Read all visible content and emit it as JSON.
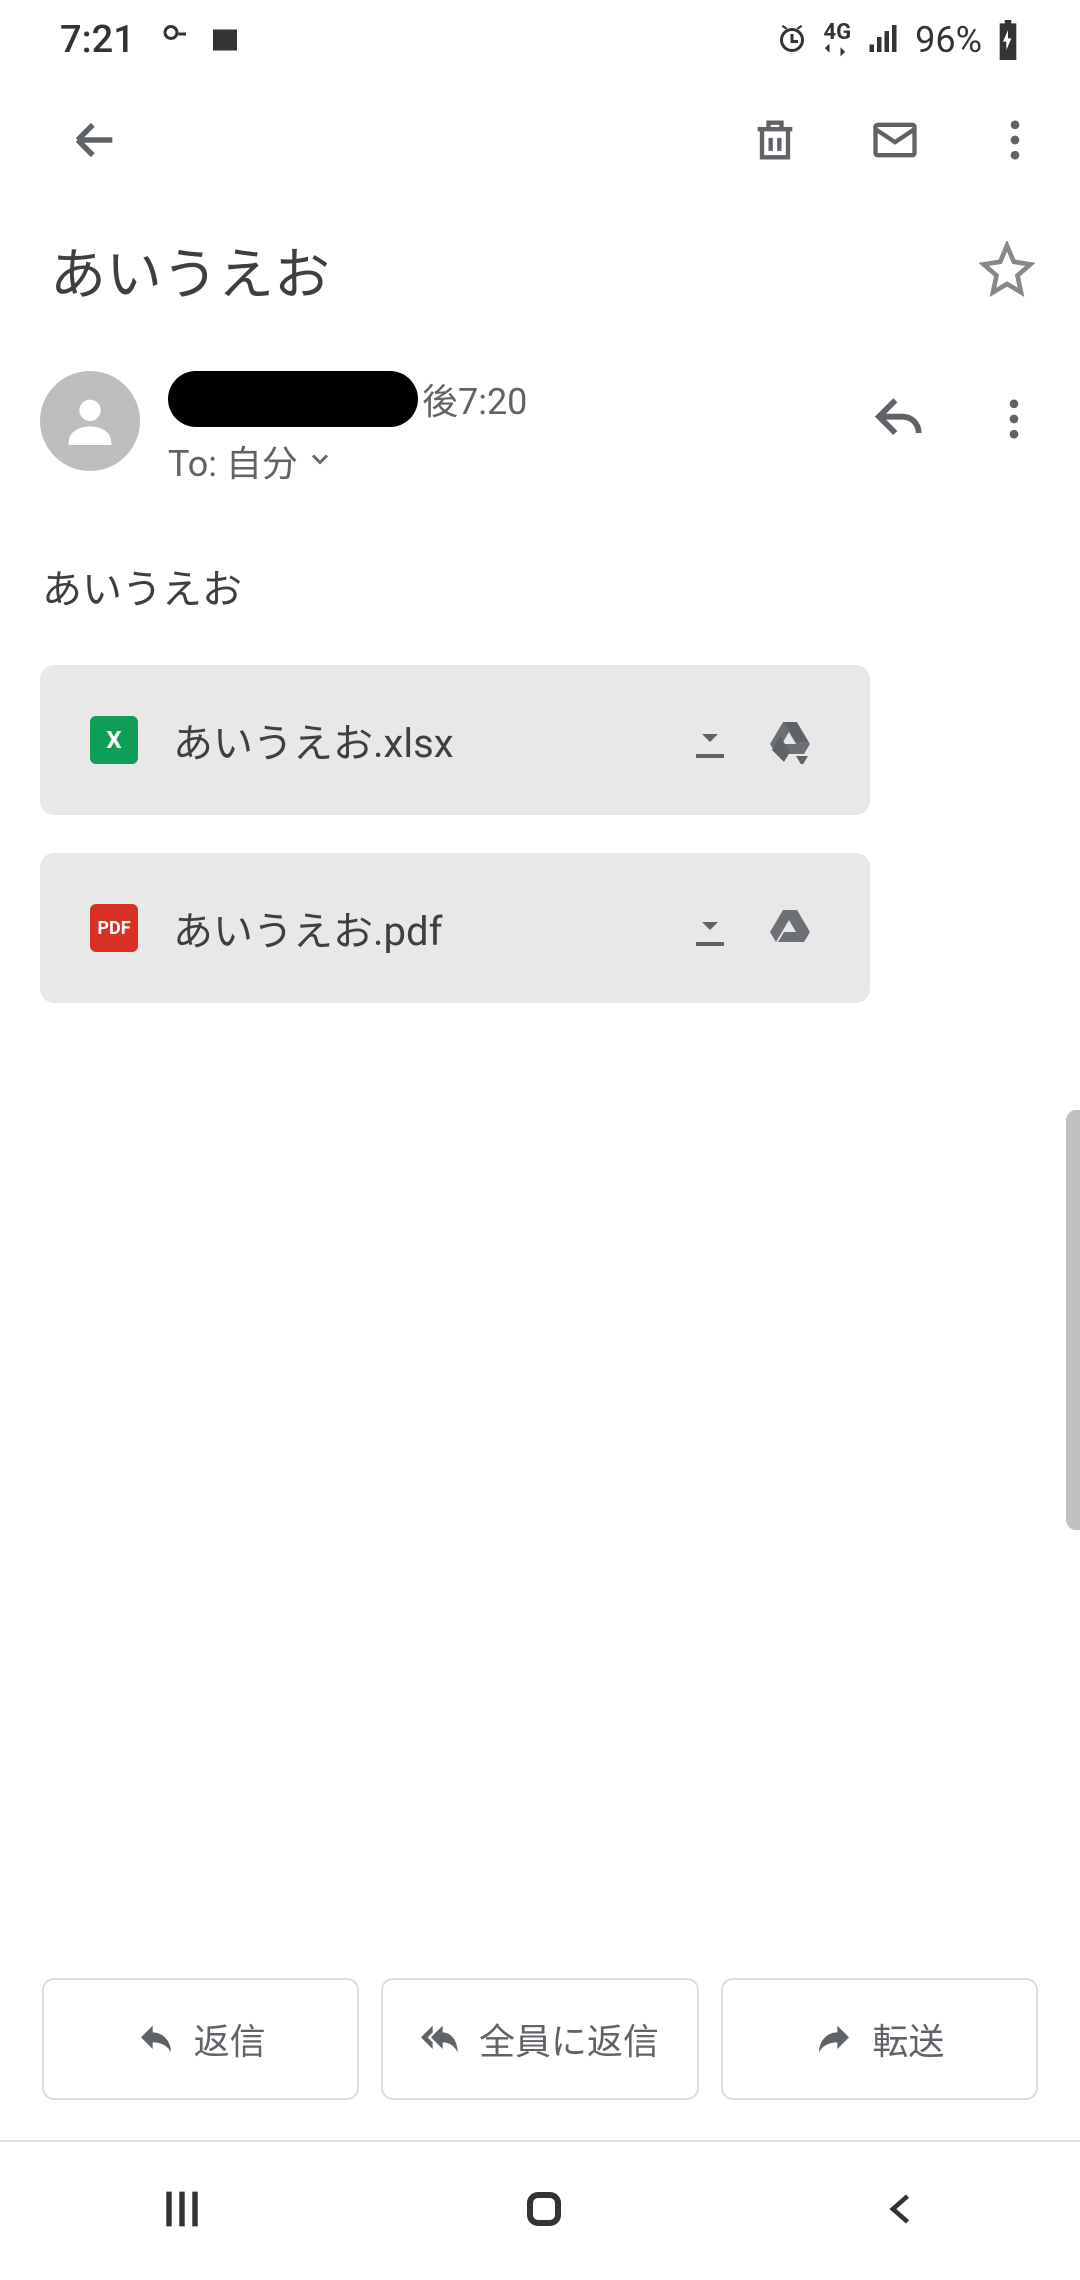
{
  "status": {
    "time": "7:21",
    "network_label": "4G",
    "battery": "96%"
  },
  "subject": "あいうえお",
  "message": {
    "time": "後7:20",
    "to_label": "To: 自分"
  },
  "body": "あいうえお",
  "attachments": [
    {
      "type": "xlsx",
      "badge": "X",
      "filename": "あいうえお.xlsx"
    },
    {
      "type": "pdf",
      "badge": "PDF",
      "filename": "あいうえお.pdf"
    }
  ],
  "actions": {
    "reply": "返信",
    "reply_all": "全員に返信",
    "forward": "転送"
  }
}
